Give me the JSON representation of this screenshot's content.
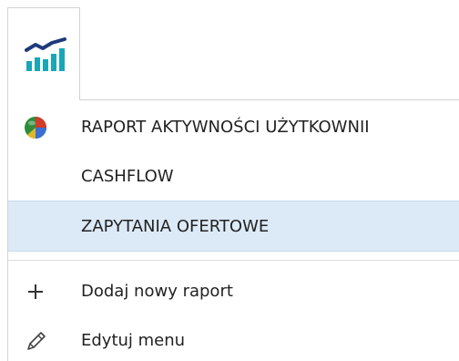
{
  "menu": {
    "reports": [
      {
        "label": "RAPORT AKTYWNOŚCI UŻYTKOWNII",
        "icon": "pie-chart-icon"
      },
      {
        "label": "CASHFLOW",
        "icon": ""
      },
      {
        "label": "ZAPYTANIA OFERTOWE",
        "icon": "",
        "selected": true
      }
    ],
    "actions": [
      {
        "label": "Dodaj nowy raport",
        "icon": "plus-icon"
      },
      {
        "label": "Edytuj menu",
        "icon": "pencil-icon"
      }
    ]
  },
  "colors": {
    "icon_teal": "#1aa6b7",
    "icon_navy": "#1f3a7a",
    "selected_bg": "#dceaf7",
    "text": "#222222"
  }
}
